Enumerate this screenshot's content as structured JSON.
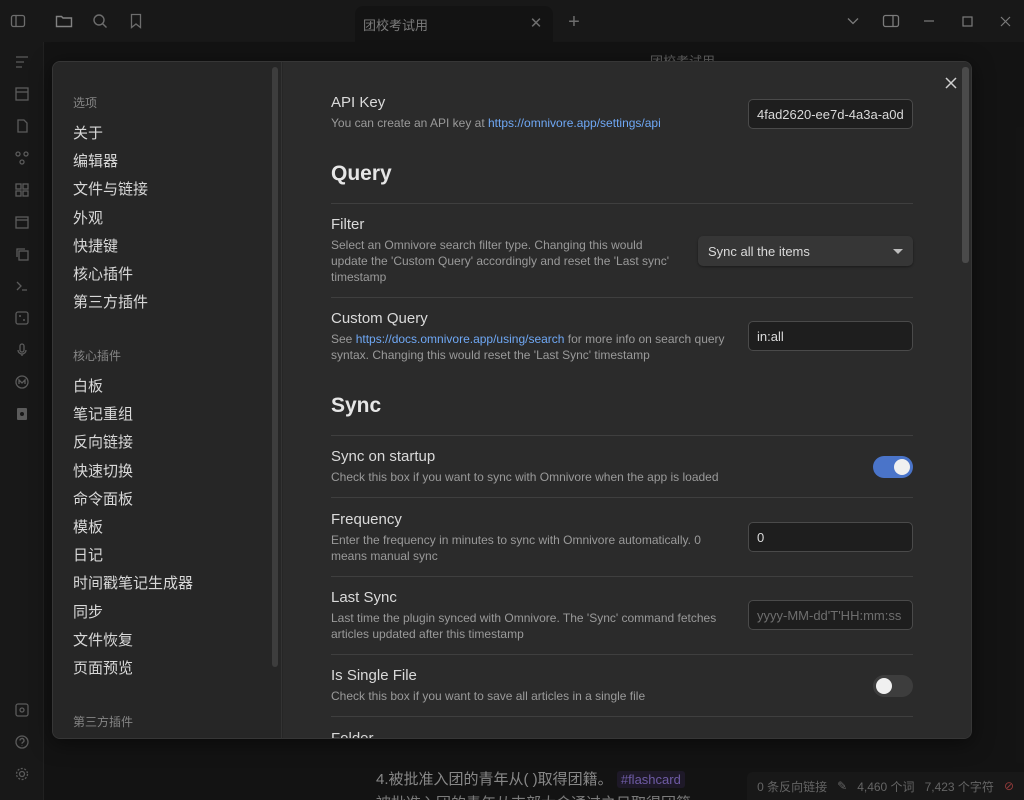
{
  "titlebar": {
    "tab_title": "团校考试用",
    "icons": [
      "sidebar-toggle-icon",
      "folder-icon",
      "search-icon",
      "bookmark-icon"
    ]
  },
  "editor": {
    "header_title": "团校考试用",
    "line1": "4.被批准入团的青年从(    )取得团籍。",
    "tag": "#flashcard",
    "line2": "被批准入团的青年从支部大会通过之日取得团籍",
    "status": {
      "backlinks": "0 条反向链接",
      "words": "4,460 个词",
      "chars": "7,423 个字符"
    }
  },
  "settings_sidebar": {
    "heading_options": "选项",
    "options": [
      "关于",
      "编辑器",
      "文件与链接",
      "外观",
      "快捷键",
      "核心插件",
      "第三方插件"
    ],
    "heading_core": "核心插件",
    "core_plugins": [
      "白板",
      "笔记重组",
      "反向链接",
      "快速切换",
      "命令面板",
      "模板",
      "日记",
      "时间戳笔记生成器",
      "同步",
      "文件恢复",
      "页面预览"
    ],
    "heading_third": "第三方插件"
  },
  "settings": {
    "api_key": {
      "name": "API Key",
      "desc_prefix": "You can create an API key at ",
      "desc_link": "https://omnivore.app/settings/api",
      "value": "4fad2620-ee7d-4a3a-a0d"
    },
    "query_title": "Query",
    "filter": {
      "name": "Filter",
      "desc": "Select an Omnivore search filter type. Changing this would update the 'Custom Query' accordingly and reset the 'Last sync' timestamp",
      "selected": "Sync all the items"
    },
    "custom_query": {
      "name": "Custom Query",
      "desc_prefix": "See ",
      "desc_link": "https://docs.omnivore.app/using/search",
      "desc_suffix": " for more info on search query syntax. Changing this would reset the 'Last Sync' timestamp",
      "value": "in:all"
    },
    "sync_title": "Sync",
    "sync_on_startup": {
      "name": "Sync on startup",
      "desc": "Check this box if you want to sync with Omnivore when the app is loaded",
      "enabled": true
    },
    "frequency": {
      "name": "Frequency",
      "desc": "Enter the frequency in minutes to sync with Omnivore automatically. 0 means manual sync",
      "value": "0"
    },
    "last_sync": {
      "name": "Last Sync",
      "desc": "Last time the plugin synced with Omnivore. The 'Sync' command fetches articles updated after this timestamp",
      "placeholder": "yyyy-MM-dd'T'HH:mm:ss"
    },
    "single_file": {
      "name": "Is Single File",
      "desc": "Check this box if you want to save all articles in a single file",
      "enabled": false
    },
    "folder": {
      "name": "Folder"
    }
  },
  "colors": {
    "accent": "#4a74c9",
    "link": "#6fa8f5",
    "tag": "#a88bfa"
  }
}
